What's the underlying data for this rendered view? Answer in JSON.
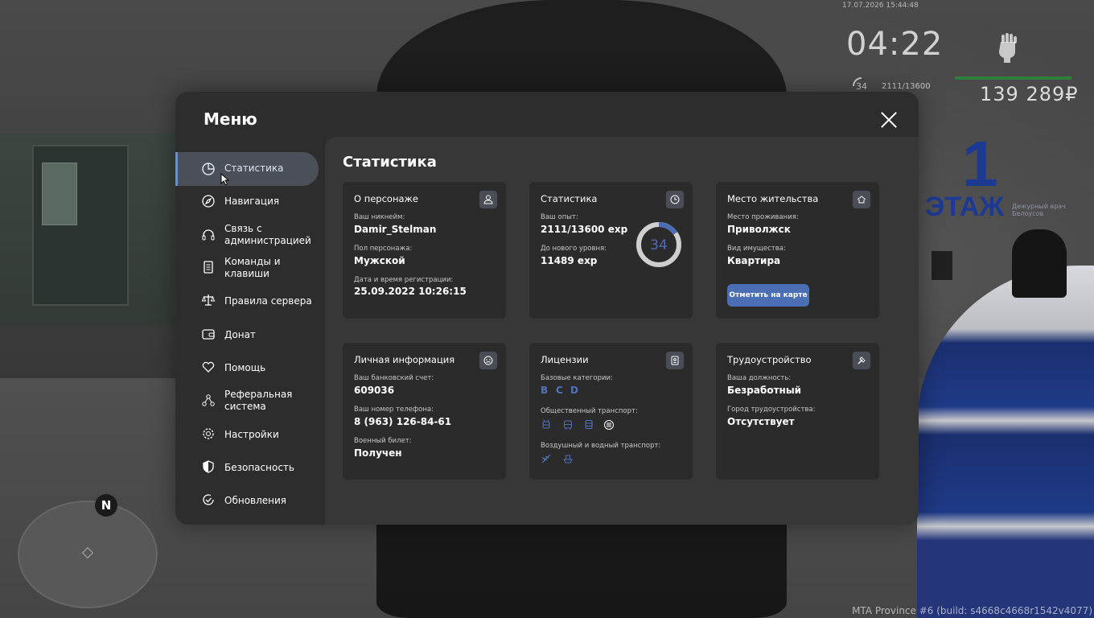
{
  "hud": {
    "date": "17.07.2026 15:44:48",
    "time": "04:22",
    "level": "34",
    "exp": "2111/13600",
    "money": "139 289₽"
  },
  "world": {
    "floor_number": "1",
    "floor_label": "ЭТАЖ",
    "floor_sub": "Дежурный врач Белоусов"
  },
  "minimap": {
    "north": "N"
  },
  "build_info": "MTA Province #6 (build: s4668c4668r1542v4077)",
  "menu": {
    "title": "Меню",
    "sidebar": [
      {
        "label": "Статистика",
        "icon": "pie-chart-icon",
        "active": true
      },
      {
        "label": "Навигация",
        "icon": "compass-icon"
      },
      {
        "label": "Связь с администрацией",
        "icon": "headset-icon"
      },
      {
        "label": "Команды и клавиши",
        "icon": "document-icon"
      },
      {
        "label": "Правила сервера",
        "icon": "scales-icon"
      },
      {
        "label": "Донат",
        "icon": "wallet-icon"
      },
      {
        "label": "Помощь",
        "icon": "heart-hands-icon"
      },
      {
        "label": "Реферальная система",
        "icon": "network-icon"
      },
      {
        "label": "Настройки",
        "icon": "gear-icon"
      },
      {
        "label": "Безопасность",
        "icon": "shield-icon"
      },
      {
        "label": "Обновления",
        "icon": "refresh-check-icon"
      }
    ]
  },
  "content": {
    "title": "Статистика",
    "cards": {
      "character": {
        "title": "О персонаже",
        "nickname_label": "Ваш никнейм:",
        "nickname": "Damir_Stelman",
        "gender_label": "Пол персонажа:",
        "gender": "Мужской",
        "reg_label": "Дата и время регистрации:",
        "reg_date": "25.09.2022 10:26:15"
      },
      "stats": {
        "title": "Статистика",
        "exp_label": "Ваш опыт:",
        "exp": "2111/13600 exp",
        "next_label": "До нового уровня:",
        "next": "11489 exp",
        "level": "34",
        "progress": 0.155
      },
      "residence": {
        "title": "Место жительства",
        "place_label": "Место проживания:",
        "place": "Приволжск",
        "property_label": "Вид имущества:",
        "property": "Квартира",
        "button": "Отметить на карте"
      },
      "personal": {
        "title": "Личная информация",
        "bank_label": "Ваш банковский счет:",
        "bank": "609036",
        "phone_label": "Ваш номер телефона:",
        "phone": "8 (963) 126-84-61",
        "military_label": "Военный билет:",
        "military": "Получен"
      },
      "licenses": {
        "title": "Лицензии",
        "basic_label": "Базовые категории:",
        "categories": [
          "B",
          "C",
          "D"
        ],
        "public_label": "Общественный транспорт:",
        "public_icons": [
          "trolleybus-icon",
          "bus-icon",
          "tram-icon",
          "metro-icon"
        ],
        "air_label": "Воздушный и водный транспорт:",
        "air_icons": [
          "plane-icon",
          "boat-icon"
        ]
      },
      "employment": {
        "title": "Трудоустройство",
        "position_label": "Ваша должность:",
        "position": "Безработный",
        "city_label": "Город трудоустройства:",
        "city": "Отсутствует"
      }
    }
  },
  "colors": {
    "accent": "#4b6eb4",
    "panel": "#2d2d2d",
    "content": "#373737",
    "card": "#2b2b2b",
    "active_item": "#4a4f58"
  }
}
